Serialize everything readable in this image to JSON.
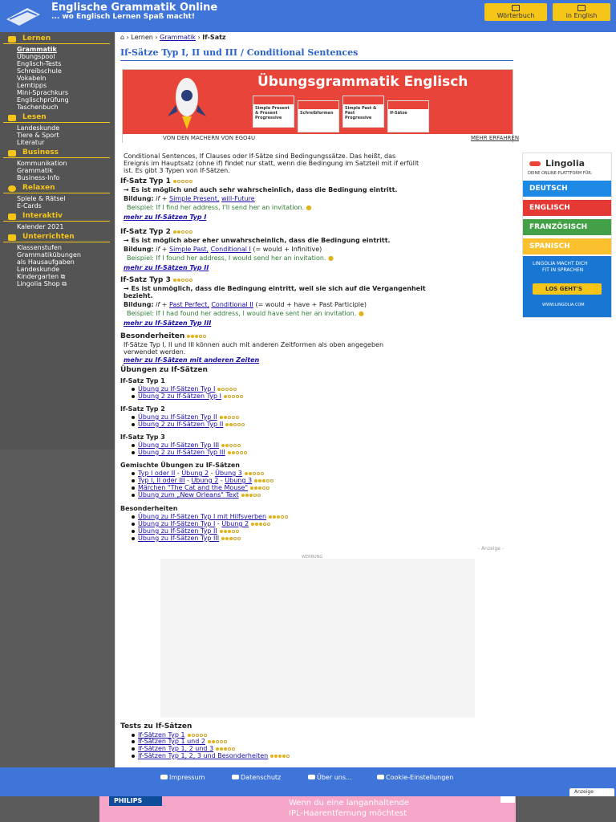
{
  "header": {
    "title": "Englische Grammatik Online",
    "subtitle": "... wo Englisch Lernen Spaß macht!",
    "btn_dict": "Wörterbuch",
    "btn_lang": "in English"
  },
  "sidebar": [
    {
      "head": "Lernen",
      "items": [
        "Grammatik",
        "Übungspool",
        "Englisch-Tests",
        "Schreibschule",
        "Vokabeln",
        "Lerntipps",
        "Mini-Sprachkurs",
        "Englischprüfung",
        "Taschenbuch"
      ]
    },
    {
      "head": "Lesen",
      "items": [
        "Landeskunde",
        "Tiere & Sport",
        "Literatur"
      ]
    },
    {
      "head": "Business",
      "items": [
        "Kommunikation",
        "Grammatik",
        "Business-Info"
      ]
    },
    {
      "head": "Relaxen",
      "items": [
        "Spiele & Rätsel",
        "E-Cards"
      ]
    },
    {
      "head": "Interaktiv",
      "items": [
        "Kalender 2021"
      ]
    },
    {
      "head": "Unterrichten",
      "items": [
        "Klassenstufen",
        "Grammatikübungen",
        "als Hausaufgaben",
        "Landeskunde",
        "Kindergarten ⧉",
        "Lingolia Shop ⧉"
      ]
    }
  ],
  "breadcrumb": {
    "c1": "Lernen",
    "c2": "Grammatik",
    "c3": "If-Satz"
  },
  "page_title": "If-Sätze Typ I, II und III / Conditional Sentences",
  "promo": {
    "title": "Übungsgrammatik Englisch",
    "from": "VON DEN MACHERN VON EGO4U",
    "more": "MEHR ERFAHREN",
    "books": [
      "Simple Present & Present Progressive",
      "Schreibformen",
      "Simple Past & Past Progressive",
      "If-Sätze"
    ]
  },
  "intro": [
    "Conditional Sentences, If Clauses oder If-Sätze sind Bedingungssätze. Das heißt, das",
    "Ereignis im Hauptsatz (ohne if) findet nur statt, wenn die Bedingung im Satzteil mit if erfüllt",
    "ist. Es gibt 3 Typen von If-Sätzen."
  ],
  "types": [
    {
      "head": "If-Satz Typ 1",
      "rule": "→ Es ist möglich und auch sehr wahrscheinlich, dass die Bedingung eintritt.",
      "form_label": "Bildung:",
      "form_a": "if +",
      "form_b": "Simple Present,",
      "form_c": "will-Future",
      "form_d": "",
      "ex": "Beispiel: If I find her address, I'll send her an invitation.",
      "more": "mehr zu If-Sätzen Typ I"
    },
    {
      "head": "If-Satz Typ 2",
      "rule": "→ Es ist möglich aber eher unwahrscheinlich, dass die Bedingung eintritt.",
      "form_label": "Bildung:",
      "form_a": "if +",
      "form_b": "Simple Past,",
      "form_c": "Conditional I",
      "form_d": "(= would + Infinitive)",
      "ex": "Beispiel: If I found her address, I would send her an invitation.",
      "more": "mehr zu If-Sätzen Typ II"
    },
    {
      "head": "If-Satz Typ 3",
      "rule": "→ Es ist unmöglich, dass die Bedingung eintritt, weil sie sich auf die Vergangenheit",
      "rule2": "bezieht.",
      "form_label": "Bildung:",
      "form_a": "if +",
      "form_b": "Past Perfect,",
      "form_c": "Conditional II",
      "form_d": "(= would + have + Past Participle)",
      "ex": "Beispiel: If I had found her address, I would have sent her an invitation.",
      "more": "mehr zu If-Sätzen Typ III"
    }
  ],
  "special": {
    "head": "Besonderheiten",
    "text1": "If-Sätze Typ I, II und III können auch mit anderen Zeitformen als oben angegeben",
    "text2": "verwendet werden.",
    "more": "mehr zu If-Sätzen mit anderen Zeiten"
  },
  "exercises": {
    "head": "Übungen zu If-Sätzen",
    "g1": "If-Satz Typ 1",
    "g1a": "Übung zu If-Sätzen Typ I",
    "g1b": "Übung 2 zu If-Sätzen Typ I",
    "g2": "If-Satz Typ 2",
    "g2a": "Übung zu If-Sätzen Typ II",
    "g2b": "Übung 2 zu If-Sätzen Typ II",
    "g3": "If-Satz Typ 3",
    "g3a": "Übung zu If-Sätzen Typ III",
    "g3b": "Übung 2 zu If-Sätzen Typ III",
    "g4": "Gemischte Übungen zu IF-Sätzen",
    "g4a": "Typ I oder II",
    "g4a2": "Übung 2",
    "g4a3": "Übung 3",
    "g4b": "Typ I, II oder III",
    "g4b2": "Übung 2",
    "g4b3": "Übung 3",
    "g4c": "Märchen \"The Cat and the Mouse\"",
    "g4d": "Übung zum „New Orleans\" Text",
    "g5": "Besonderheiten",
    "g5a": "Übung zu If-Sätzen Typ I mit Hilfsverben",
    "g5b": "Übung zu If-Sätzen Typ I",
    "g5b2": "Übung 2",
    "g5c": "Übung zu If-Sätzen Typ II",
    "g5d": "Übung zu If-Sätzen Typ III",
    "sep": " - "
  },
  "ad": {
    "anzeige": "- Anzeige -",
    "werbung": "WERBUNG"
  },
  "tests": {
    "head": "Tests zu If-Sätzen",
    "t1": "If-Sätzen Typ 1",
    "t2": "If-Sätzen Typ 1 und 2",
    "t3": "If-Sätzen Typ 1, 2 und 3",
    "t4": "If-Sätzen Typ 1, 2, 3 und Besonderheiten"
  },
  "lingolia": {
    "brand": "Lingolia",
    "tag": "DEINE ONLINE-PLATTFORM FÜR:",
    "langs": [
      "DEUTSCH",
      "ENGLISCH",
      "FRANZÖSISCH",
      "SPANISCH"
    ],
    "claim1": "LINGOLIA MACHT DICH",
    "claim2": "FIT IN SPRACHEN",
    "cta": "LOS GEHT'S",
    "url": "WWW.LINGOLIA.COM"
  },
  "footer": {
    "impressum": "Impressum",
    "datenschutz": "Datenschutz",
    "about": "Über uns...",
    "cookies": "Cookie-Einstellungen",
    "anzeige": "Anzeige"
  },
  "bottom_ad": {
    "brand": "PHILIPS",
    "l1": "Wenn du eine langanhaltende",
    "l2": "IPL-Haarentfernung möchtest"
  },
  "colors": {
    "header": "#3f74d8",
    "accent": "#f5c518",
    "promo": "#e8443a"
  }
}
